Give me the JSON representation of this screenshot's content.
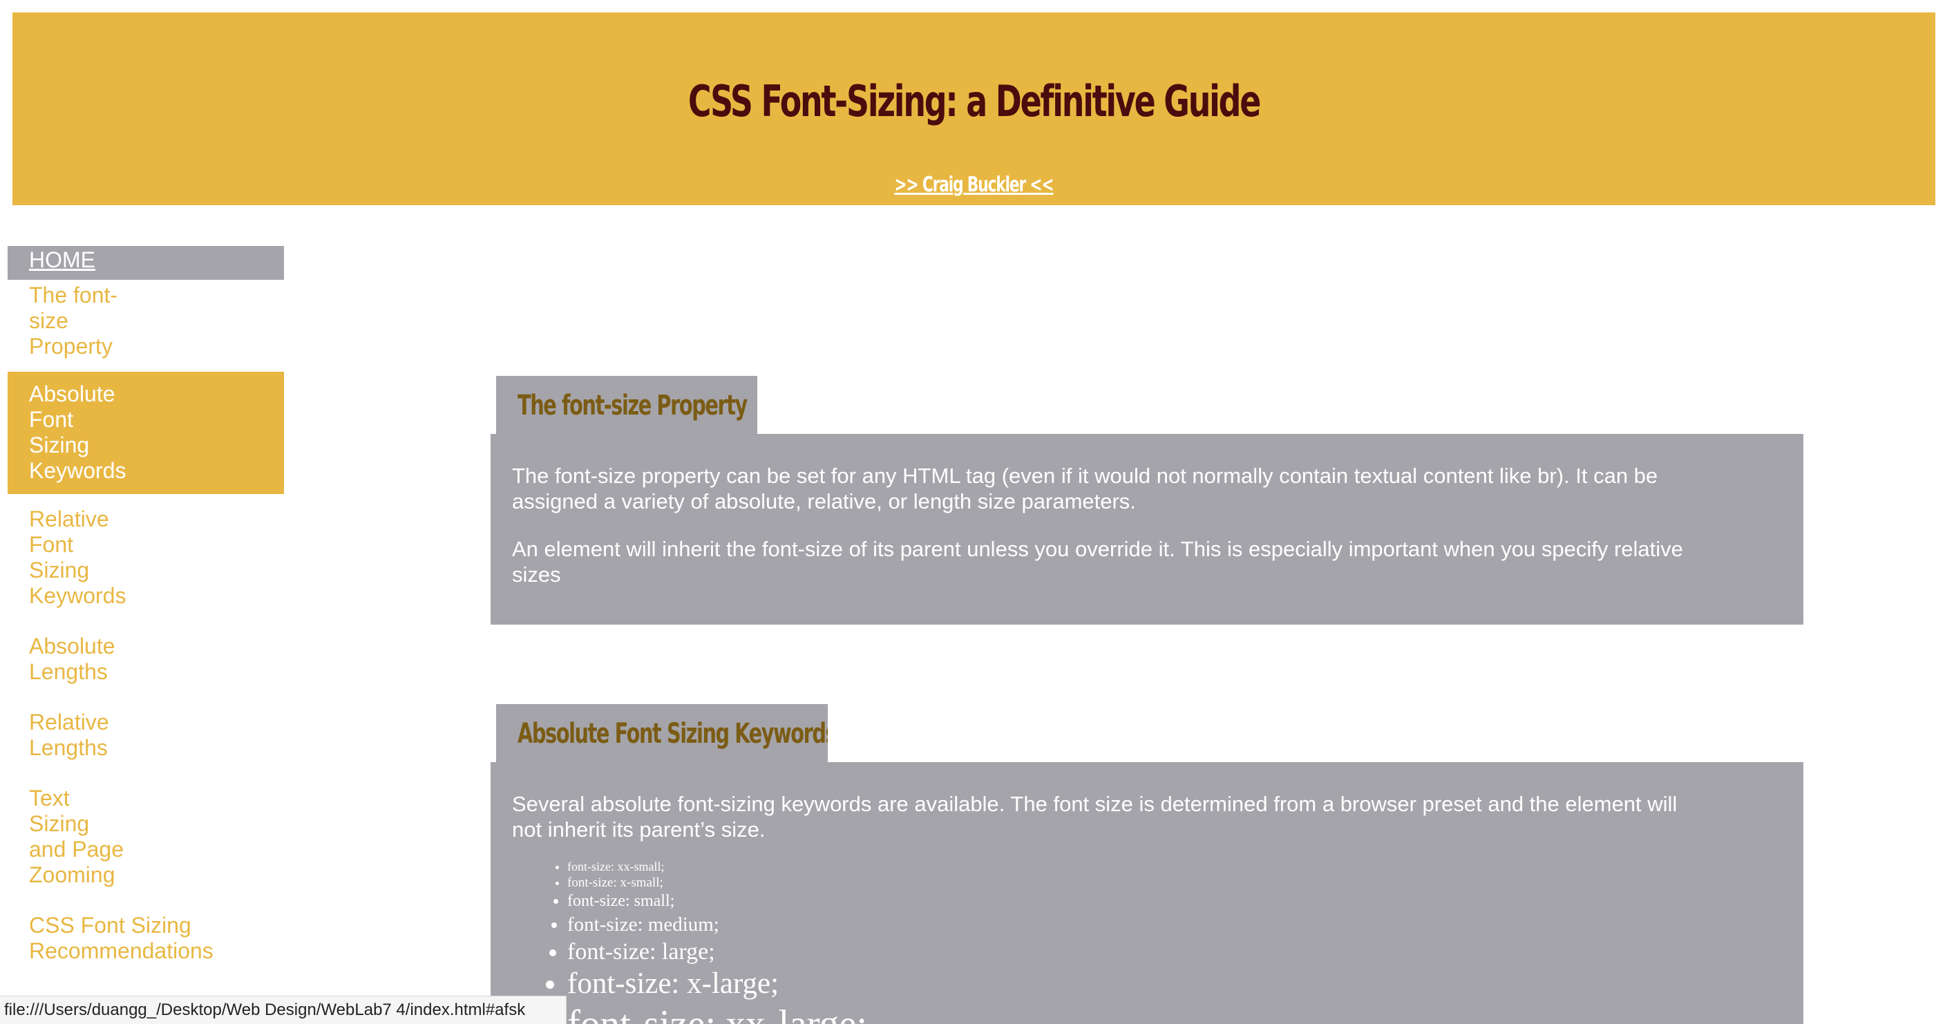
{
  "header": {
    "title": "CSS Font-Sizing: a Definitive Guide",
    "author_link": ">> Craig Buckler <<"
  },
  "sidebar": {
    "items": [
      {
        "label": "HOME"
      },
      {
        "label": "The font-size Property"
      },
      {
        "label": "Absolute Font Sizing Keywords"
      },
      {
        "label": "Relative Font Sizing Keywords"
      },
      {
        "label": "Absolute Lengths"
      },
      {
        "label": "Relative Lengths"
      },
      {
        "label": "Text Sizing and Page Zooming"
      },
      {
        "label": "CSS Font Sizing Recommendations"
      }
    ]
  },
  "sections": [
    {
      "heading": "The font-size Property",
      "paragraphs": [
        "The font-size property can be set for any HTML tag (even if it would not normally contain textual content like br). It can be assigned a variety of absolute, relative, or length size parameters.",
        "An element will inherit the font-size of its parent unless you override it. This is especially important when you specify relative sizes"
      ]
    },
    {
      "heading": "Absolute Font Sizing Keywords",
      "paragraphs": [
        "Several absolute font-sizing keywords are available. The font size is determined from a browser preset and the element will not inherit its parent’s size."
      ],
      "keywords": [
        "font-size: xx-small;",
        "font-size: x-small;",
        "font-size: small;",
        "font-size: medium;",
        "font-size: large;",
        "font-size: x-large;",
        "font-size: xx-large;"
      ]
    }
  ],
  "status_bar": {
    "url": "file:///Users/duangg_/Desktop/Web Design/WebLab7 4/index.html#afsk"
  },
  "colors": {
    "accent": "#e8b742",
    "panel": "#a5a4aa",
    "title": "#4a0c0c",
    "heading_text": "#7b5c14"
  }
}
